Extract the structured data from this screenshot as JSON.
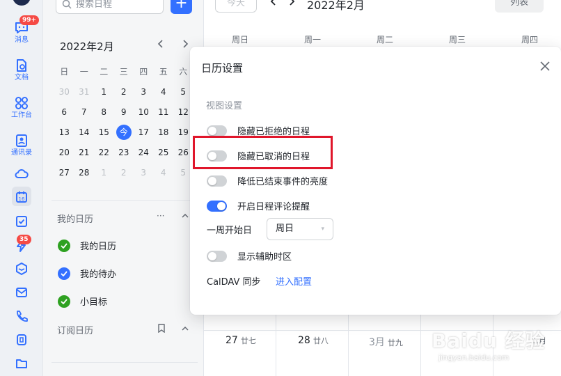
{
  "nav": {
    "messages": {
      "label": "消息",
      "badge": "99+"
    },
    "docs": {
      "label": "文档"
    },
    "workspace": {
      "label": "工作台"
    },
    "contacts": {
      "label": "通讯录"
    },
    "calendar_day": "16",
    "approval_badge": "35"
  },
  "sidebar": {
    "search_placeholder": "搜索日程",
    "add_label": "+",
    "mini_calendar": {
      "month": "2022年2月",
      "weekdays": [
        "日",
        "一",
        "二",
        "三",
        "四",
        "五",
        "六"
      ],
      "weeks": [
        [
          "30",
          "31",
          "1",
          "2",
          "3",
          "4",
          "5"
        ],
        [
          "6",
          "7",
          "8",
          "9",
          "10",
          "11",
          "12"
        ],
        [
          "13",
          "14",
          "15",
          "今",
          "17",
          "18",
          "19"
        ],
        [
          "20",
          "21",
          "22",
          "23",
          "24",
          "25",
          "26"
        ],
        [
          "27",
          "28",
          "1",
          "2",
          "3",
          "4",
          "5"
        ]
      ]
    },
    "my_calendars": {
      "title": "我的日历",
      "more": "···",
      "items": [
        {
          "label": "我的日历",
          "color": "#2ea121"
        },
        {
          "label": "我的待办",
          "color": "#3370ff"
        },
        {
          "label": "小目标",
          "color": "#2ea121"
        }
      ]
    },
    "subscribed": {
      "title": "订阅日历"
    }
  },
  "header": {
    "today": "今天",
    "month": "2022年2月",
    "view": "列表",
    "weekdays": [
      "周日",
      "周一",
      "周二",
      "周三",
      "周四"
    ]
  },
  "grid": {
    "bottom_row": [
      {
        "day": "27",
        "lunar": "廿七"
      },
      {
        "day": "28",
        "lunar": "廿八"
      },
      {
        "day": "3月",
        "lunar": "廿九"
      },
      {
        "day": "",
        "lunar": ""
      },
      {
        "day": "",
        "lunar": "二月"
      }
    ]
  },
  "dialog": {
    "title": "日历设置",
    "section": "视图设置",
    "options": [
      {
        "label": "隐藏已拒绝的日程",
        "on": false
      },
      {
        "label": "隐藏已取消的日程",
        "on": false
      },
      {
        "label": "降低已结束事件的亮度",
        "on": false
      },
      {
        "label": "开启日程评论提醒",
        "on": true
      }
    ],
    "week_start_label": "一周开始日",
    "week_start_value": "周日",
    "aux_timezone": {
      "label": "显示辅助时区",
      "on": false
    },
    "caldav_label": "CalDAV 同步",
    "caldav_link": "进入配置"
  },
  "watermark": {
    "main": "Baidu 经验",
    "sub": "jingyan.baidu.com"
  }
}
